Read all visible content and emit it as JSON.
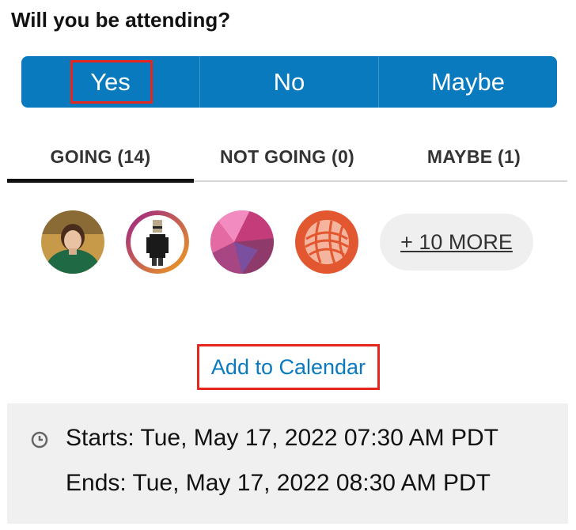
{
  "question": "Will you be attending?",
  "rsvp": {
    "options": [
      "Yes",
      "No",
      "Maybe"
    ],
    "selected": "Yes"
  },
  "tabs": [
    {
      "label": "GOING (14)",
      "active": true
    },
    {
      "label": "NOT GOING (0)",
      "active": false
    },
    {
      "label": "MAYBE (1)",
      "active": false
    }
  ],
  "attendees": {
    "avatars": [
      "person-photo-avatar",
      "pixel-art-avatar",
      "pink-geometric-avatar",
      "yarn-ball-avatar"
    ],
    "more_label": "+ 10 MORE"
  },
  "calendar": {
    "label": "Add to Calendar"
  },
  "event_times": {
    "starts": "Starts: Tue, May 17, 2022 07:30 AM PDT",
    "ends": "Ends: Tue, May 17, 2022 08:30 AM PDT"
  },
  "colors": {
    "accent": "#0a7abf",
    "highlight": "#e5261f",
    "panel": "#f0f0f0"
  }
}
